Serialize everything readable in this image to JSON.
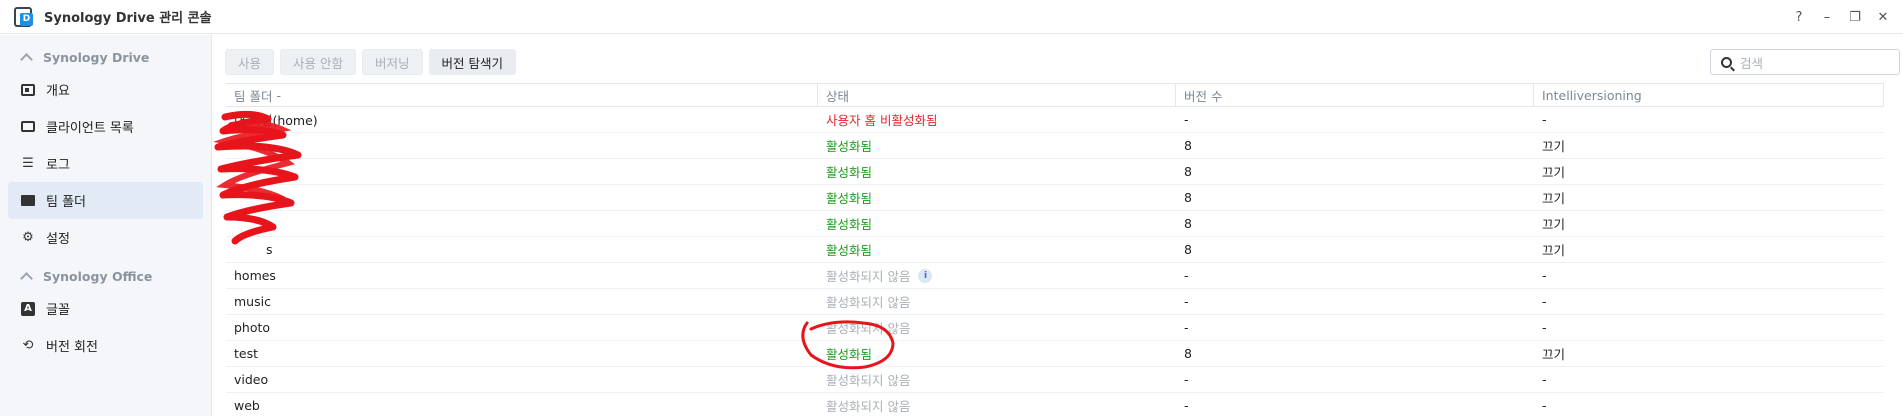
{
  "window": {
    "title": "Synology Drive 관리 콘솔",
    "controls": [
      "?",
      "–",
      "❐",
      "✕"
    ]
  },
  "sidebar": {
    "sections": [
      {
        "header": "Synology Drive",
        "items": [
          {
            "label": "개요",
            "icon": "overview-icon"
          },
          {
            "label": "클라이언트 목록",
            "icon": "client-list-icon"
          },
          {
            "label": "로그",
            "icon": "log-list-icon"
          },
          {
            "label": "팀 폴더",
            "icon": "team-folder-icon",
            "active": true
          },
          {
            "label": "설정",
            "icon": "gear-icon"
          }
        ]
      },
      {
        "header": "Synology Office",
        "items": [
          {
            "label": "글꼴",
            "icon": "font-icon"
          },
          {
            "label": "버전 회전",
            "icon": "history-icon"
          }
        ]
      }
    ]
  },
  "toolbar": {
    "enable_label": "사용",
    "disable_label": "사용 안함",
    "versioning_label": "버저닝",
    "version_explorer_label": "버전 탐색기"
  },
  "search": {
    "placeholder": "검색"
  },
  "table": {
    "headers": {
      "folder": "팀 폴더",
      "sort_indicator": "-",
      "status": "상태",
      "versions": "버전 수",
      "intelliversioning": "Intelliversioning"
    },
    "rows": [
      {
        "name": "내 파일(home)",
        "status": "사용자 홈 비활성화됨",
        "status_type": "red",
        "versions": "-",
        "intelli": "-"
      },
      {
        "name": "",
        "status": "활성화됨",
        "status_type": "green",
        "versions": "8",
        "intelli": "끄기"
      },
      {
        "name": "",
        "status": "활성화됨",
        "status_type": "green",
        "versions": "8",
        "intelli": "끄기"
      },
      {
        "name": "",
        "status": "활성화됨",
        "status_type": "green",
        "versions": "8",
        "intelli": "끄기"
      },
      {
        "name": "",
        "status": "활성화됨",
        "status_type": "green",
        "versions": "8",
        "intelli": "끄기"
      },
      {
        "name": "s",
        "status": "활성화됨",
        "status_type": "green",
        "versions": "8",
        "intelli": "끄기"
      },
      {
        "name": "homes",
        "status": "활성화되지 않음",
        "status_type": "gray",
        "versions": "-",
        "intelli": "-",
        "info": "i"
      },
      {
        "name": "music",
        "status": "활성화되지 않음",
        "status_type": "gray",
        "versions": "-",
        "intelli": "-"
      },
      {
        "name": "photo",
        "status": "활성화되지 않음",
        "status_type": "gray",
        "versions": "-",
        "intelli": "-"
      },
      {
        "name": "test",
        "status": "활성화됨",
        "status_type": "green",
        "versions": "8",
        "intelli": "끄기"
      },
      {
        "name": "video",
        "status": "활성화되지 않음",
        "status_type": "gray",
        "versions": "-",
        "intelli": "-"
      },
      {
        "name": "web",
        "status": "활성화되지 않음",
        "status_type": "gray",
        "versions": "-",
        "intelli": "-"
      }
    ]
  },
  "colors": {
    "status_red": "#e2272f",
    "status_green": "#1e9a1e",
    "status_gray": "#a9b0b8",
    "active_nav": "#e2eaf5",
    "annotation": "#e8141c"
  }
}
